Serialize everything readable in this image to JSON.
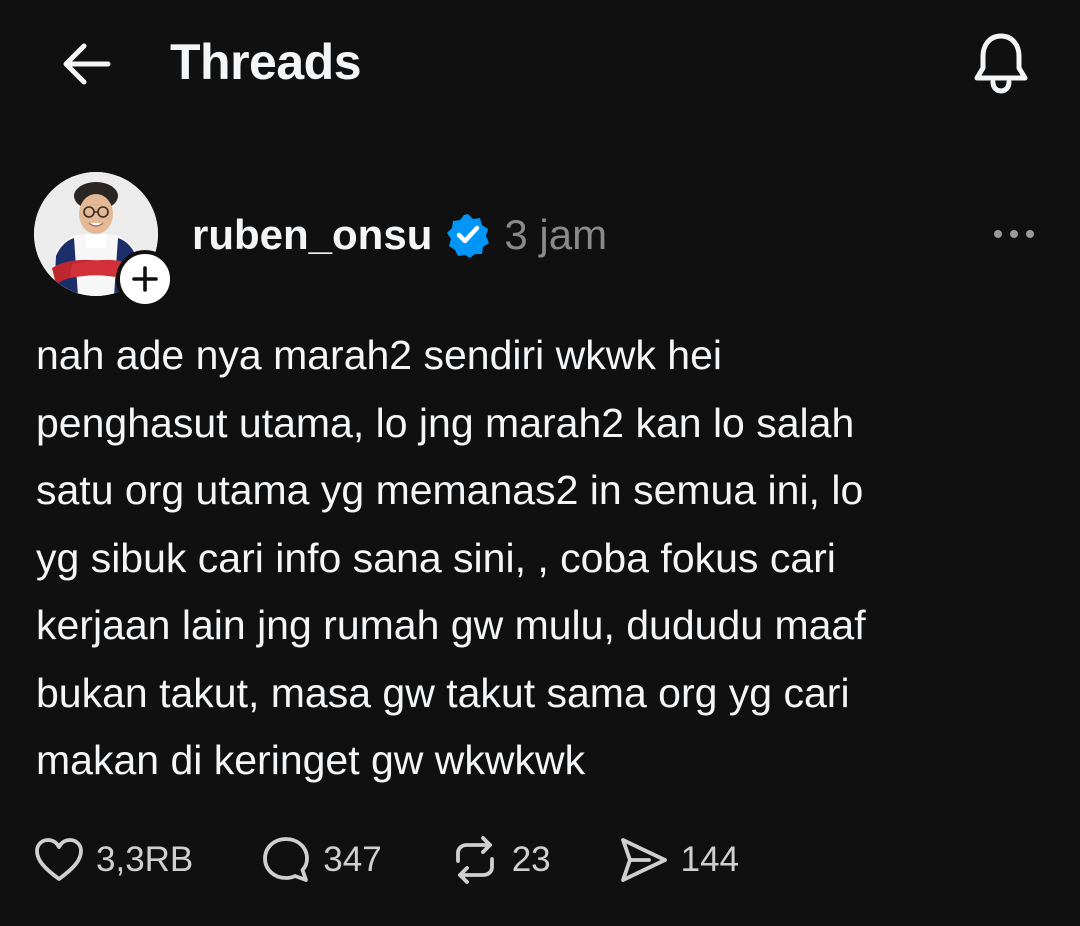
{
  "header": {
    "title": "Threads",
    "back_icon": "arrow-left-icon",
    "notification_icon": "bell-icon"
  },
  "post": {
    "author": {
      "username": "ruben_onsu",
      "verified": true,
      "avatar_icon": "avatar-photo",
      "follow_icon": "plus-icon"
    },
    "time": "3 jam",
    "more_icon": "more-horizontal-icon",
    "lines": [
      "nah ade nya marah2 sendiri wkwk hei",
      "penghasut utama, lo jng marah2 kan lo salah",
      "satu org utama yg memanas2 in semua ini, lo",
      "yg sibuk cari info sana sini, , coba fokus cari",
      "kerjaan lain jng rumah gw mulu, dududu maaf",
      "bukan takut, masa gw takut sama org yg cari",
      "makan di keringet gw wkwkwk"
    ],
    "stats": {
      "likes": "3,3RB",
      "replies": "347",
      "reposts": "23",
      "shares": "144"
    }
  },
  "colors": {
    "background": "#101010",
    "text": "#f3f5f7",
    "muted": "#8a8a8a",
    "verified": "#0095f6"
  }
}
